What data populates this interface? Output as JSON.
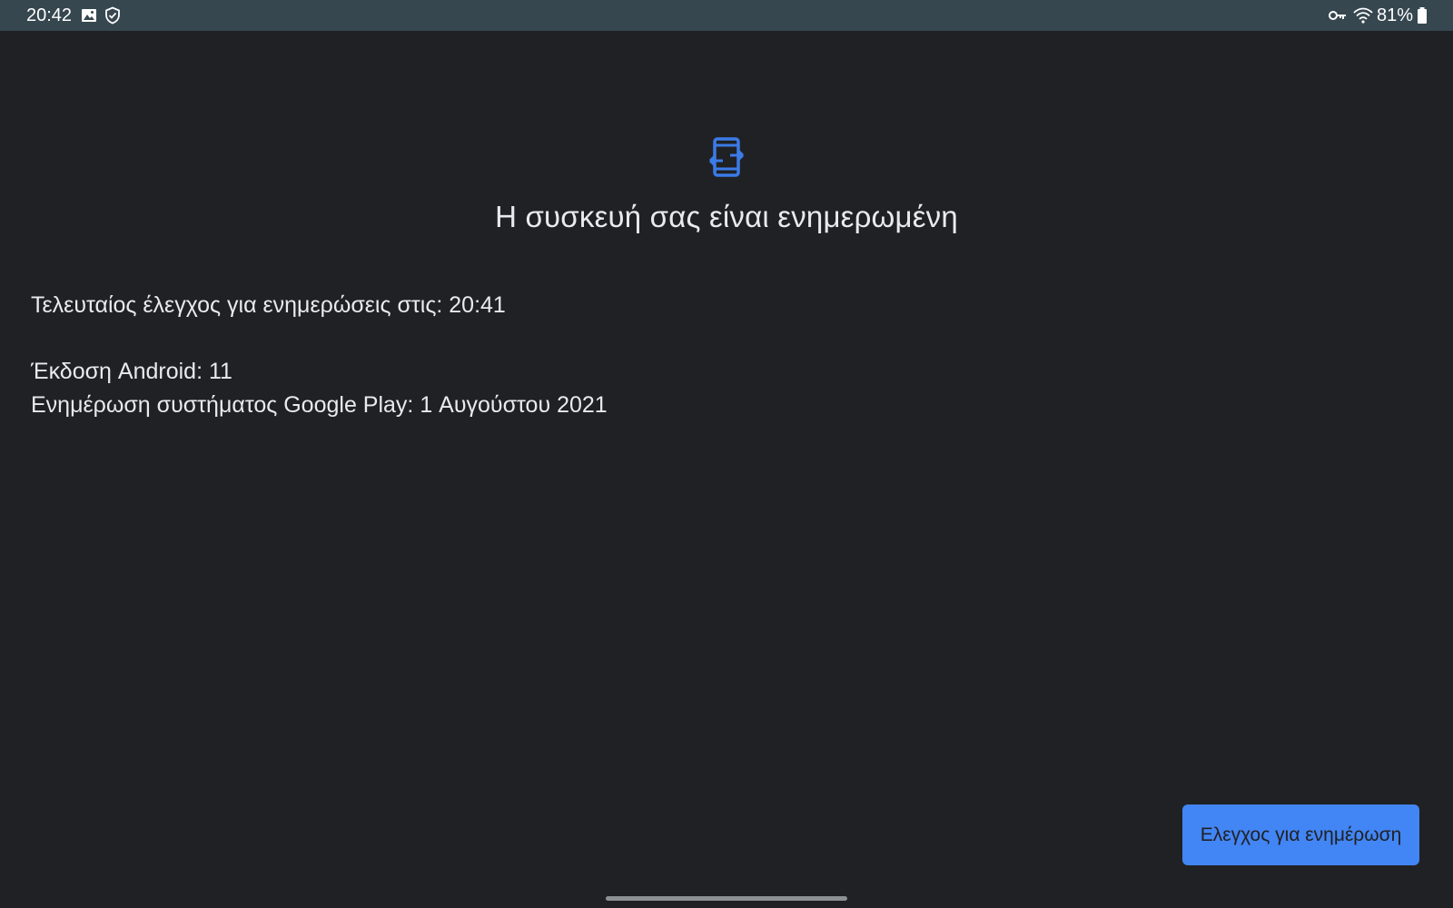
{
  "status_bar": {
    "time": "20:42",
    "left_icons": [
      "image-icon",
      "shield-check-icon"
    ],
    "right_icons": [
      "vpn-key-icon",
      "wifi-icon",
      "battery-icon"
    ],
    "battery_percent": "81%"
  },
  "main": {
    "icon": "system-update-icon",
    "title": "Η συσκευή σας είναι ενημερωμένη",
    "last_check": "Τελευταίος έλεγχος για ενημερώσεις στις: 20:41",
    "android_version": "Έκδοση Android: 11",
    "google_play_update": "Ενημέρωση συστήματος Google Play: 1 Αυγούστου 2021"
  },
  "actions": {
    "check_button_label": "Ελεγχος για ενημέρωση"
  },
  "colors": {
    "background": "#202124",
    "status_bar": "#36474f",
    "accent": "#4285f4",
    "icon_blue": "#3b7be8",
    "text": "#e8eaed"
  }
}
